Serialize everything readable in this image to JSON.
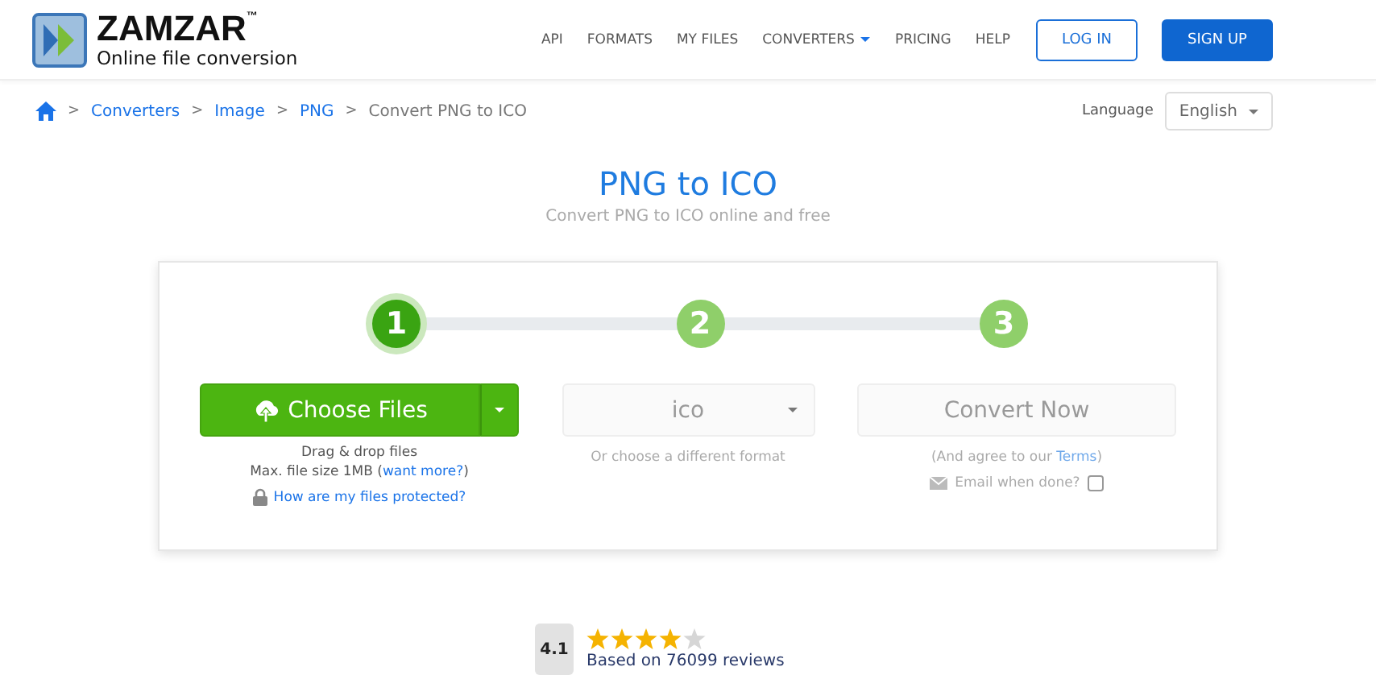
{
  "logo": {
    "name": "ZAMZAR",
    "trademark": "™",
    "tagline": "Online file conversion"
  },
  "nav": [
    {
      "label": "API",
      "dropdown": false
    },
    {
      "label": "FORMATS",
      "dropdown": false
    },
    {
      "label": "MY FILES",
      "dropdown": false
    },
    {
      "label": "CONVERTERS",
      "dropdown": true
    },
    {
      "label": "PRICING",
      "dropdown": false
    },
    {
      "label": "HELP",
      "dropdown": false
    }
  ],
  "auth": {
    "login": "LOG IN",
    "signup": "SIGN UP"
  },
  "breadcrumb": {
    "separator": ">",
    "links": [
      "Converters",
      "Image",
      "PNG"
    ],
    "current": "Convert PNG to ICO"
  },
  "language": {
    "label": "Language",
    "value": "English"
  },
  "title": "PNG to ICO",
  "subtitle": "Convert PNG to ICO online and free",
  "steps": [
    {
      "number": "1",
      "selected": true
    },
    {
      "number": "2",
      "selected": false
    },
    {
      "number": "3",
      "selected": false
    }
  ],
  "upload": {
    "button": "Choose Files",
    "hint": "Drag & drop files",
    "max_size": "Max. file size 1MB (",
    "more_link": "want more?",
    "max_size_end": ")",
    "protect_link": "How are my files protected?"
  },
  "format": {
    "value": "ico",
    "hint": "Or choose a different format"
  },
  "convert": {
    "button": "Convert Now",
    "terms_before": "(And agree to our ",
    "terms_link": "Terms",
    "terms_after": ")",
    "email_label": "Email when done?",
    "email_checked": false
  },
  "rating": {
    "score": "4.1",
    "stars": 4,
    "reviews": "Based on 76099 reviews"
  }
}
